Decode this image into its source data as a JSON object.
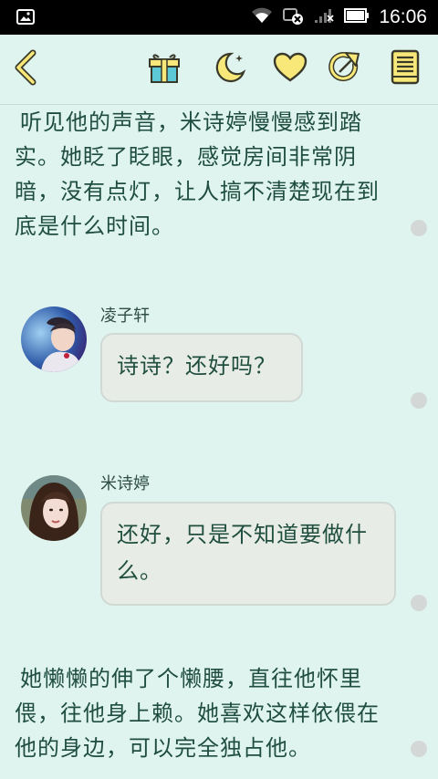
{
  "status_bar": {
    "time": "16:06",
    "icons": [
      "image-notification-icon",
      "wifi-icon",
      "data-off-icon",
      "signal-icon",
      "battery-icon"
    ]
  },
  "toolbar": {
    "icons": [
      "back-icon",
      "gift-icon",
      "night-mode-icon",
      "favorite-icon",
      "share-icon",
      "catalog-icon"
    ]
  },
  "story": {
    "paragraph_1": "听见他的声音，米诗婷慢慢感到踏实。她眨了眨眼，感觉房间非常阴暗，没有点灯，让人搞不清楚现在到底是什么时间。",
    "messages": [
      {
        "speaker": "凌子轩",
        "text": "诗诗？还好吗？"
      },
      {
        "speaker": "米诗婷",
        "text": "还好，只是不知道要做什么。"
      }
    ],
    "paragraph_2": "她懒懒的伸了个懒腰，直往他怀里偎，往他身上赖。她喜欢这样依偎在他的身边，可以完全独占他。"
  },
  "colors": {
    "background": "#dff3ef",
    "text": "#1f4e3f",
    "icon_yellow": "#f7e879",
    "icon_outline": "#3a3a2a"
  }
}
